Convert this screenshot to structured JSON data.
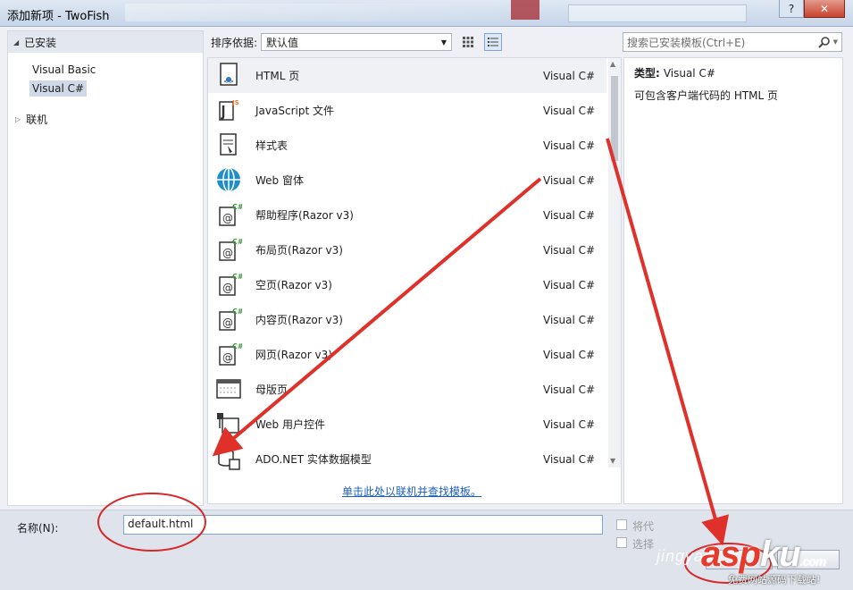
{
  "window": {
    "title": "添加新项 - TwoFish",
    "help_label": "?",
    "close_label": "✕"
  },
  "left_pane": {
    "installed_label": "已安装",
    "languages": [
      "Visual Basic",
      "Visual C#"
    ],
    "selected_language": "Visual C#",
    "online_label": "联机"
  },
  "toolbar": {
    "sort_label": "排序依据:",
    "sort_value": "默认值"
  },
  "templates": [
    {
      "name": "HTML 页",
      "lang": "Visual C#",
      "icon": "html-page-icon"
    },
    {
      "name": "JavaScript 文件",
      "lang": "Visual C#",
      "icon": "javascript-file-icon"
    },
    {
      "name": "样式表",
      "lang": "Visual C#",
      "icon": "stylesheet-icon"
    },
    {
      "name": "Web 窗体",
      "lang": "Visual C#",
      "icon": "web-form-icon"
    },
    {
      "name": "帮助程序(Razor v3)",
      "lang": "Visual C#",
      "icon": "razor-helper-icon"
    },
    {
      "name": "布局页(Razor v3)",
      "lang": "Visual C#",
      "icon": "razor-layout-icon"
    },
    {
      "name": "空页(Razor v3)",
      "lang": "Visual C#",
      "icon": "razor-empty-icon"
    },
    {
      "name": "内容页(Razor v3)",
      "lang": "Visual C#",
      "icon": "razor-content-icon"
    },
    {
      "name": "网页(Razor v3)",
      "lang": "Visual C#",
      "icon": "razor-webpage-icon"
    },
    {
      "name": "母版页",
      "lang": "Visual C#",
      "icon": "master-page-icon"
    },
    {
      "name": "Web 用户控件",
      "lang": "Visual C#",
      "icon": "web-user-control-icon"
    },
    {
      "name": "ADO.NET 实体数据模型",
      "lang": "Visual C#",
      "icon": "ado-net-model-icon"
    }
  ],
  "online_link": "单击此处以联机并查找模板。",
  "search": {
    "placeholder": "搜索已安装模板(Ctrl+E)"
  },
  "details": {
    "type_label": "类型:",
    "type_value": "Visual C#",
    "description": "可包含客户端代码的 HTML 页"
  },
  "bottom": {
    "name_label": "名称(N):",
    "name_value": "default.html",
    "checkbox1_label": "将代",
    "checkbox2_label": "选择"
  },
  "watermark": {
    "site": "jingyan",
    "brand_a": "asp",
    "brand_b": "ku",
    "brand_c": ".com",
    "sub": "免费网站源码下载站!"
  },
  "colors": {
    "annotation_red": "#e0302a",
    "link_blue": "#1a5ec3",
    "selection": "#cfd9e8"
  }
}
